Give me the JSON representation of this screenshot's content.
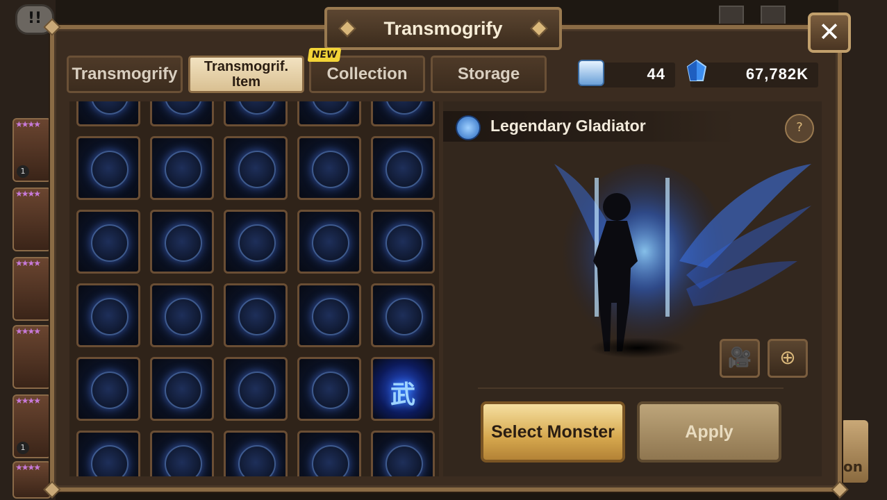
{
  "header": {
    "title": "Transmogrify",
    "close_label": "✕",
    "chat_label": "!!"
  },
  "tabs": [
    {
      "label": "Transmogrify",
      "active": false
    },
    {
      "label": "Transmogrif.\nItem",
      "active": true
    },
    {
      "label": "Collection",
      "active": false,
      "badge": "NEW"
    },
    {
      "label": "Storage",
      "active": false
    }
  ],
  "currency": {
    "scrolls": "44",
    "crystals": "67,782K"
  },
  "side_cards": [
    {
      "level": "1"
    },
    {
      "level": ""
    },
    {
      "level": ""
    },
    {
      "level": ""
    },
    {
      "level": "1"
    }
  ],
  "grid": {
    "special_glyph": "武",
    "rows": 6,
    "cols": 5
  },
  "preview": {
    "item_name": "Legendary Gladiator",
    "help_label": "?",
    "video_icon": "camera-icon",
    "zoom_icon": "magnifier-icon"
  },
  "buttons": {
    "select_monster": "Select Monster",
    "apply": "Apply"
  },
  "background": {
    "edge_button_label": "on"
  },
  "colors": {
    "frame": "#8a6b45",
    "panel": "#3b2c20",
    "gold_button": "#d6a84e",
    "accent_blue": "#3a8cff"
  }
}
